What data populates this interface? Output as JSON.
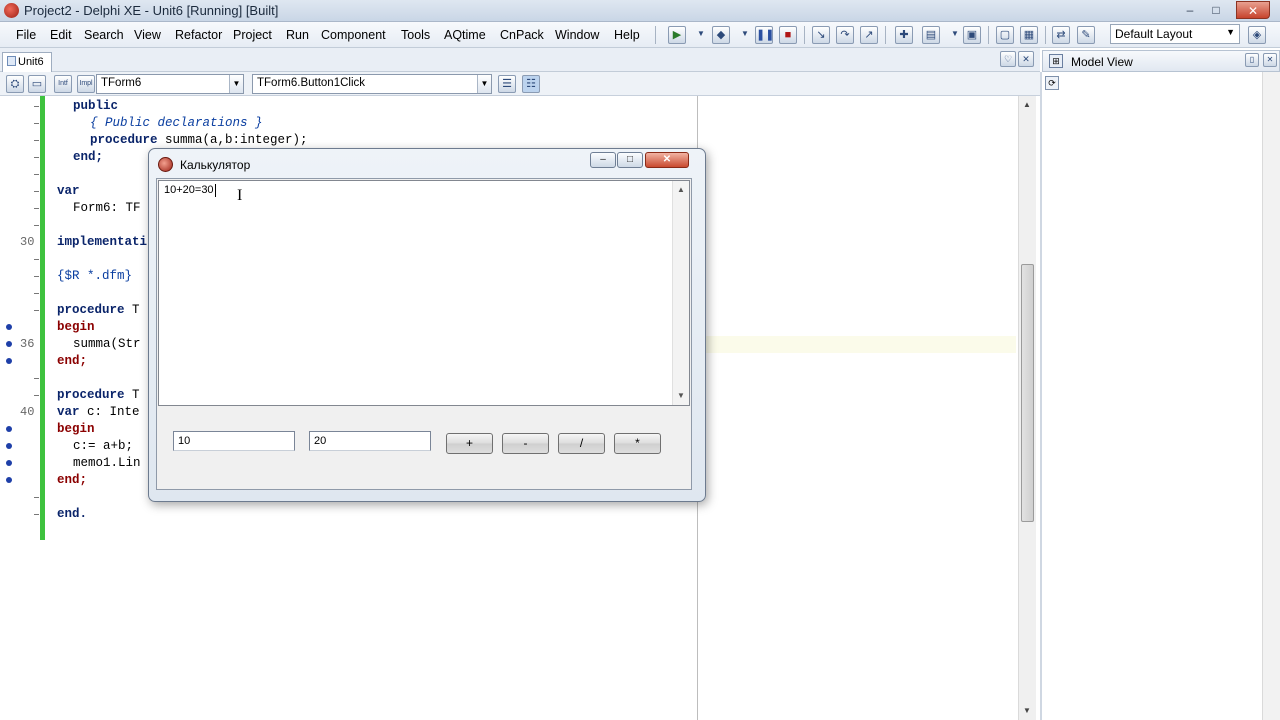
{
  "window": {
    "title": "Project2 - Delphi XE - Unit6 [Running] [Built]",
    "min_glyph": "–",
    "max_glyph": "□",
    "close_glyph": "✕"
  },
  "menu": {
    "items": [
      "File",
      "Edit",
      "Search",
      "View",
      "Refactor",
      "Project",
      "Run",
      "Component",
      "Tools",
      "AQtime",
      "CnPack",
      "Window",
      "Help"
    ]
  },
  "toolbar": {
    "layout_value": "Default Layout"
  },
  "tabs": {
    "active": "Unit6"
  },
  "code_toolbar": {
    "class_combo": "TForm6",
    "method_combo": "TForm6.Button1Click"
  },
  "model_view": {
    "title": "Model View"
  },
  "gutter": {
    "line_30": "30",
    "line_36": "36",
    "line_40": "40"
  },
  "code": {
    "l1": "public",
    "l2": "{ Public declarations }",
    "l3_kw": "procedure",
    "l3_rest": " summa(a,b:integer);",
    "l4": "end;",
    "l5": "var",
    "l6": "Form6: TF",
    "l7": "implementati",
    "l8": "{$R *.dfm}",
    "l9_kw": "procedure",
    "l9_rest": " T",
    "l10": "begin",
    "l11": "summa(Str",
    "l12": "end;",
    "l13_kw": "procedure",
    "l13_rest": " T",
    "l14_kw": "var",
    "l14_rest": " c: Inte",
    "l15": "begin",
    "l16": "c:= a+b;",
    "l17": "memo1.Lin",
    "l18": "end;",
    "l19": "end."
  },
  "calculator": {
    "title": "Калькулятор",
    "memo_text": "10+20=30",
    "input_a": "10",
    "input_b": "20",
    "btn_plus": "+",
    "btn_minus": "-",
    "btn_div": "/",
    "btn_mul": "*",
    "min_glyph": "–",
    "max_glyph": "□",
    "close_glyph": "✕"
  }
}
